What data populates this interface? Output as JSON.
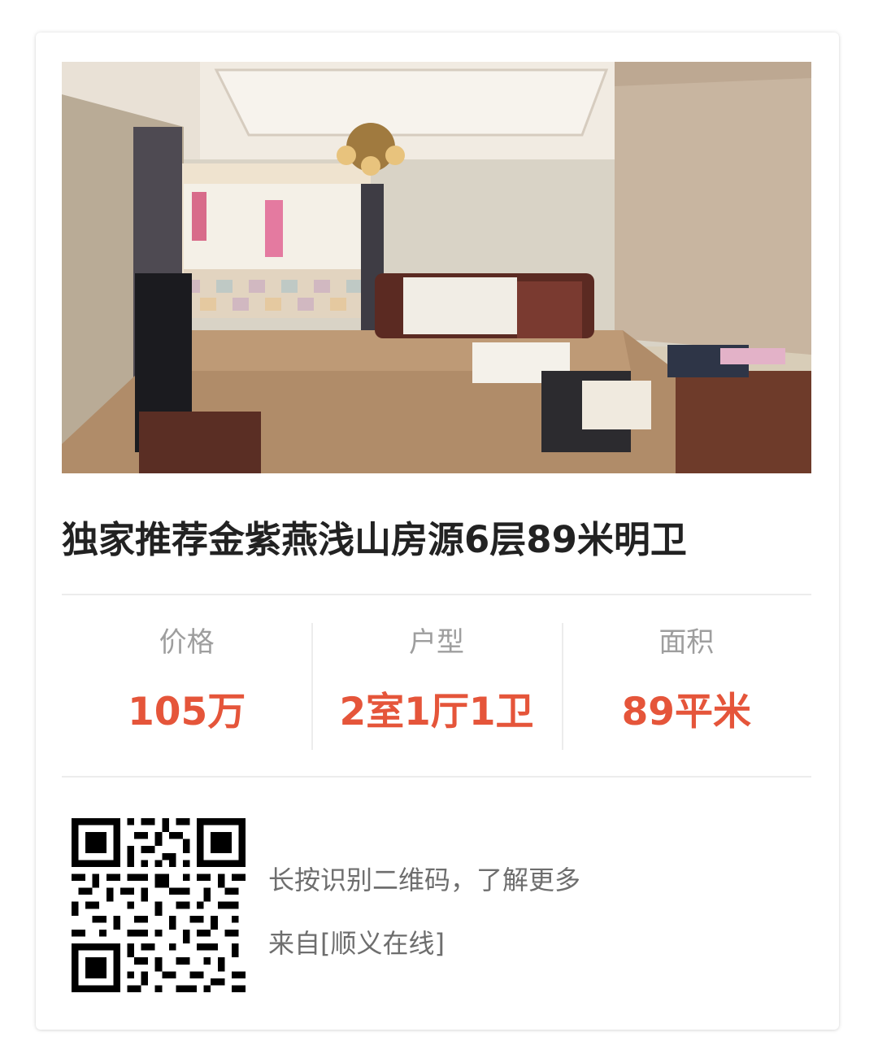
{
  "listing": {
    "title": "独家推荐金紫燕浅山房源6层89米明卫",
    "photo_icon": "living-room-photo"
  },
  "stats": [
    {
      "label": "价格",
      "value": "105万"
    },
    {
      "label": "户型",
      "value": "2室1厅1卫"
    },
    {
      "label": "面积",
      "value": "89平米"
    }
  ],
  "footer": {
    "qr_icon": "qr-code",
    "hint": "长按识别二维码，了解更多",
    "source": "来自[顺义在线]"
  },
  "colors": {
    "accent": "#e5553a",
    "label": "#9e9e9e",
    "title": "#222222",
    "divider": "#ececec"
  }
}
